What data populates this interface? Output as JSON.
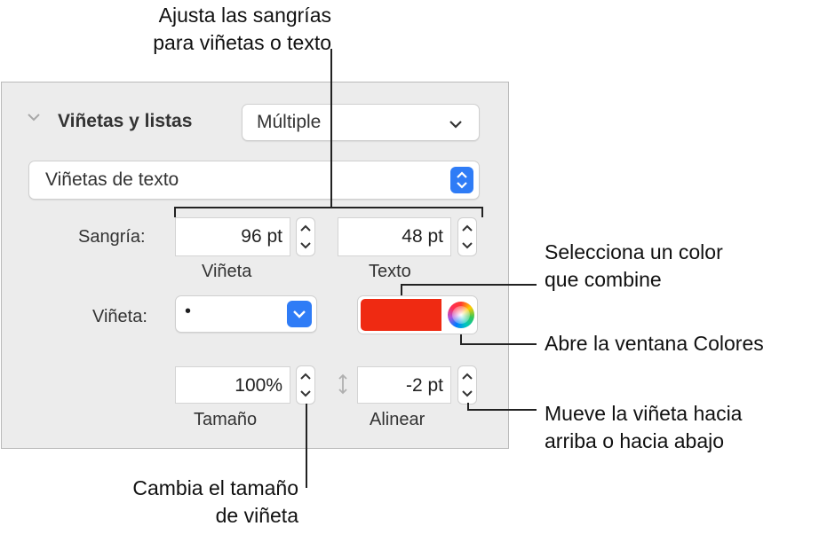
{
  "callouts": {
    "indent_top_1": "Ajusta las sangrías",
    "indent_top_2": "para viñetas o texto",
    "color_1": "Selecciona un color",
    "color_2": "que combine",
    "colors_window": "Abre la ventana Colores",
    "align_1": "Mueve la viñeta hacia",
    "align_2": "arriba o hacia abajo",
    "size_1": "Cambia el tamaño",
    "size_2": "de viñeta"
  },
  "section": {
    "title": "Viñetas y listas",
    "style_popup": "Múltiple",
    "list_type": "Viñetas de texto"
  },
  "indent": {
    "label": "Sangría:",
    "bullet_value": "96 pt",
    "bullet_caption": "Viñeta",
    "text_value": "48 pt",
    "text_caption": "Texto"
  },
  "bullet": {
    "label": "Viñeta:",
    "char": "•",
    "color": "#ef2a12"
  },
  "size": {
    "value": "100%",
    "caption": "Tamaño"
  },
  "align": {
    "value": "-2 pt",
    "caption": "Alinear"
  },
  "icons": [
    "chevron-down-icon",
    "up-down-chevron-icon",
    "stepper-icon",
    "color-wheel-icon",
    "vertical-arrows-icon"
  ]
}
